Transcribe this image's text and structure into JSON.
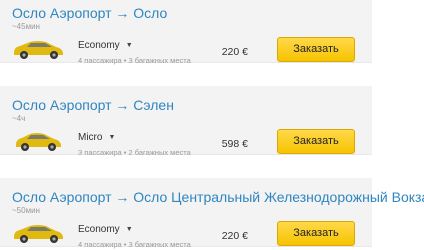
{
  "transfers": [
    {
      "route": "Осло Аэропорт → Осло",
      "duration": "~45мин",
      "car_class": "Economy",
      "capacity": "4 пассажира • 3 багажных места",
      "price": "220 €",
      "order_label": "Заказать",
      "car_color": "#e0b911"
    },
    {
      "route": "Осло Аэропорт → Сэлен",
      "duration": "~4ч",
      "car_class": "Micro",
      "capacity": "3 пассажира • 2 багажных места",
      "price": "598 €",
      "order_label": "Заказать",
      "car_color": "#e0b911"
    },
    {
      "route": "Осло Аэропорт → Осло Центральный Железнодорожный Вокзал",
      "duration": "~50мин",
      "car_class": "Economy",
      "capacity": "4 пассажира • 3 багажных места",
      "price": "220 €",
      "order_label": "Заказать",
      "car_color": "#e0b911"
    }
  ],
  "icons": {
    "class_dropdown": "chevron-down-icon",
    "car": "car-icon"
  },
  "colors": {
    "accent_link": "#2f86c0",
    "button": "#f6c400"
  }
}
